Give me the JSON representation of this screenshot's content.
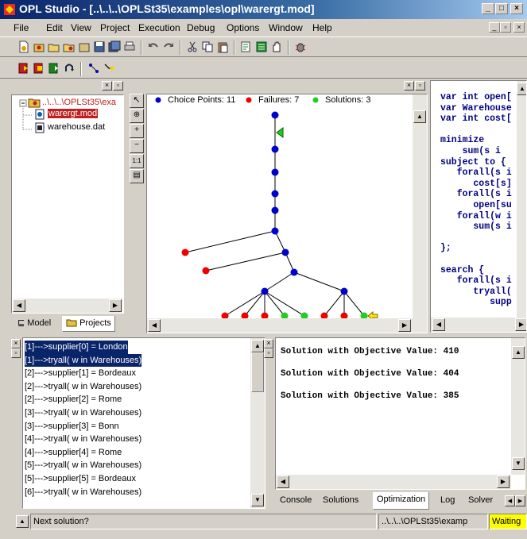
{
  "window": {
    "title": "OPL Studio - [..\\..\\..\\OPLSt35\\examples\\opl\\warergt.mod]"
  },
  "menu": [
    "File",
    "Edit",
    "View",
    "Project",
    "Execution",
    "Debug",
    "Options",
    "Window",
    "Help"
  ],
  "project_tree": {
    "root": "..\\..\\..\\OPLSt35\\exa",
    "files": [
      "warergt.mod",
      "warehouse.dat"
    ]
  },
  "project_tabs": [
    "Model",
    "Projects"
  ],
  "search_tree": {
    "legend": [
      {
        "label": "Choice Points: 11",
        "color": "#0000cc"
      },
      {
        "label": "Failures: 7",
        "color": "#ee0000"
      },
      {
        "label": "Solutions: 3",
        "color": "#22cc22"
      }
    ],
    "tool_labels": [
      "1:1"
    ]
  },
  "code_lines": [
    "var int open[",
    "var Warehouse",
    "var int cost[",
    "",
    "minimize",
    "    sum(s i",
    "subject to {",
    "   forall(s i",
    "      cost[s]",
    "   forall(s i",
    "      open[su",
    "   forall(w i",
    "      sum(s i",
    "",
    "};",
    "",
    "search {",
    "   forall(s i",
    "      tryall(",
    "         supp"
  ],
  "trace_lines": [
    "[1]--->supplier[0] = London",
    "[1]--->tryall( w in Warehouses)",
    "[2]--->supplier[1] = Bordeaux",
    "[2]--->tryall( w in Warehouses)",
    "[2]--->supplier[2] = Rome",
    "[3]--->tryall( w in Warehouses)",
    "[3]--->supplier[3] = Bonn",
    "[4]--->tryall( w in Warehouses)",
    "[4]--->supplier[4] = Rome",
    "[5]--->tryall( w in Warehouses)",
    "[5]--->supplier[5] = Bordeaux",
    "[6]--->tryall( w in Warehouses)"
  ],
  "solutions": [
    "Solution with Objective Value: 410",
    "Solution with Objective Value: 404",
    "Solution with Objective Value: 385"
  ],
  "output_tabs": [
    "Console",
    "Solutions",
    "Optimization",
    "Log",
    "Solver"
  ],
  "status": {
    "message": "Next solution?",
    "path": "..\\..\\..\\OPLSt35\\examp",
    "state": "Waiting"
  }
}
